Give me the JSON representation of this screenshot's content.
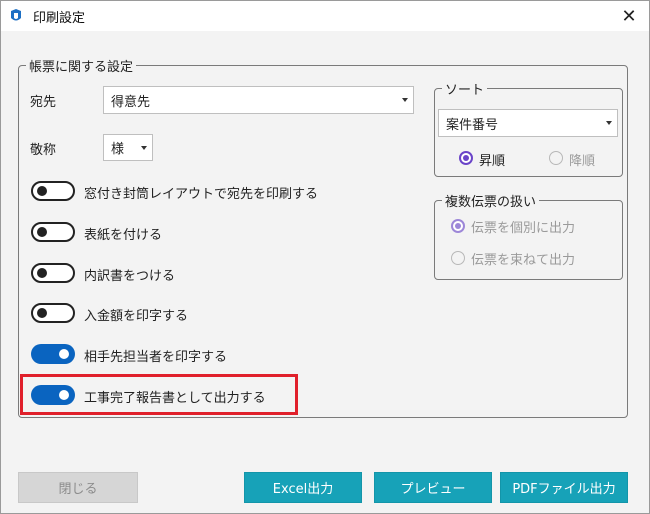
{
  "window": {
    "title": "印刷設定",
    "close_glyph": "✕"
  },
  "main_group": {
    "legend": "帳票に関する設定",
    "destination": {
      "label": "宛先",
      "value": "得意先"
    },
    "honorific": {
      "label": "敬称",
      "value": "様"
    },
    "toggles": [
      {
        "label": "窓付き封筒レイアウトで宛先を印刷する",
        "on": false
      },
      {
        "label": "表紙を付ける",
        "on": false
      },
      {
        "label": "内訳書をつける",
        "on": false
      },
      {
        "label": "入金額を印字する",
        "on": false
      },
      {
        "label": "相手先担当者を印字する",
        "on": true
      },
      {
        "label": "工事完了報告書として出力する",
        "on": true
      }
    ]
  },
  "sort_group": {
    "legend": "ソート",
    "field": "案件番号",
    "ascending": "昇順",
    "descending": "降順",
    "selected": "ascending"
  },
  "multi_group": {
    "legend": "複数伝票の扱い",
    "option_individual": "伝票を個別に出力",
    "option_bundle": "伝票を束ねて出力",
    "selected": "individual"
  },
  "buttons": {
    "close": "閉じる",
    "excel": "Excel出力",
    "preview": "プレビュー",
    "pdf": "PDFファイル出力"
  },
  "colors": {
    "toggle_on": "#0a64c0",
    "radio_selected": "#6a44c8",
    "button_primary": "#17a2b8",
    "highlight": "#e0202b"
  }
}
